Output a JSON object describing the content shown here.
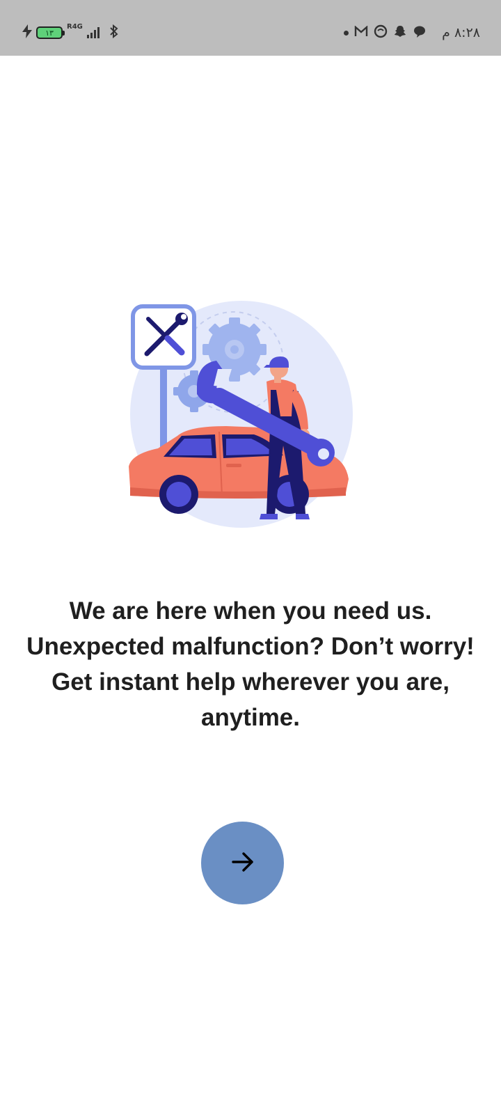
{
  "status_bar": {
    "time": "٨:٢٨ م",
    "battery_level": "١٣",
    "network_label": "R4G",
    "signal_bars_filled": 4,
    "icons": [
      "charging-bolt-icon",
      "battery-icon",
      "signal-icon",
      "bluetooth-icon",
      "notification-dot-icon",
      "gmail-icon",
      "app-notification-icon",
      "snapchat-icon",
      "chat-bubble-icon"
    ]
  },
  "onboarding": {
    "illustration": "car-mechanic-illustration",
    "message_lines": [
      "We are here when you need us.",
      "Unexpected malfunction? Don’t worry!",
      "Get instant help wherever you are,",
      "anytime."
    ],
    "next_button_icon": "arrow-right-icon"
  },
  "colors": {
    "status_bar_bg": "#bdbdbd",
    "background": "#ffffff",
    "text": "#1f1f1f",
    "button": "#6a8fc4",
    "illustration_primary": "#4f4fd6",
    "illustration_car": "#f47a63",
    "illustration_bg": "#e4e9fb"
  }
}
